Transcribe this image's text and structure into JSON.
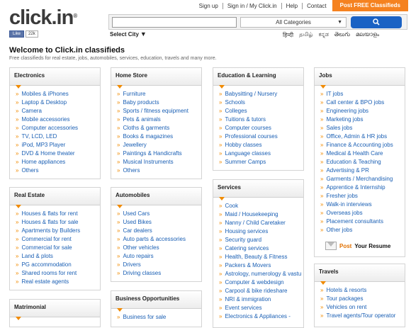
{
  "header": {
    "logo_text": "click.in",
    "logo_sup": "®",
    "like_label": "Like",
    "like_count": "22k",
    "nav": [
      "Sign up",
      "Sign in / My Click.in",
      "Help",
      "Contact"
    ],
    "post_button": "Post FREE Classifieds",
    "search_placeholder": "",
    "category_select": "All Categories",
    "city_label": "Select City",
    "languages": [
      "हिन्दी",
      "தமிழ்",
      "ಕನ್ನಡ",
      "తెలుగు",
      "മലയാളം"
    ]
  },
  "page": {
    "title": "Welcome to Click.in classifieds",
    "subtitle": "Free classifieds for real estate, jobs, automobiles, services, education, travels and many more."
  },
  "boxes": {
    "electronics": {
      "title": "Electronics",
      "items": [
        "Mobiles & iPhones",
        "Laptop & Desktop",
        "Camera",
        "Mobile accessories",
        "Computer accessories",
        "TV, LCD, LED",
        "iPod, MP3 Player",
        "DVD & Home theater",
        "Home appliances",
        "Others"
      ]
    },
    "home_store": {
      "title": "Home Store",
      "items": [
        "Furniture",
        "Baby products",
        "Sports / fitness equipment",
        "Pets & animals",
        "Cloths & garments",
        "Books & magazines",
        "Jewellery",
        "Paintings & Handicrafts",
        "Musical Instruments",
        "Others"
      ]
    },
    "education": {
      "title": "Education & Learning",
      "items": [
        "Babysitting / Nursery",
        "Schools",
        "Colleges",
        "Tuitions & tutors",
        "Computer courses",
        "Professional courses",
        "Hobby classes",
        "Language classes",
        "Summer Camps"
      ]
    },
    "jobs": {
      "title": "Jobs",
      "items": [
        "IT jobs",
        "Call center & BPO jobs",
        "Engineering jobs",
        "Marketing jobs",
        "Sales jobs",
        "Office, Admin & HR jobs",
        "Finance & Accounting jobs",
        "Medical & Health Care",
        "Education & Teaching",
        "Advertising & PR",
        "Garments / Merchandising",
        "Apprentice & Internship",
        "Fresher jobs",
        "Walk-in interviews",
        "Overseas jobs",
        "Placement consultants",
        "Other jobs"
      ]
    },
    "real_estate": {
      "title": "Real Estate",
      "items": [
        "Houses & flats for rent",
        "Houses & flats for sale",
        "Apartments by Builders",
        "Commercial for rent",
        "Commercial for sale",
        "Land & plots",
        "PG accommodation",
        "Shared rooms for rent",
        "Real estate agents"
      ]
    },
    "automobiles": {
      "title": "Automobiles",
      "items": [
        "Used Cars",
        "Used Bikes",
        "Car dealers",
        "Auto parts & accessories",
        "Other vehicles",
        "Auto repairs",
        "Drivers",
        "Driving classes"
      ]
    },
    "services": {
      "title": "Services",
      "items": [
        "Cook",
        "Maid / Housekeeping",
        "Nanny / Child Caretaker",
        "Housing services",
        "Security guard",
        "Catering services",
        "Health, Beauty & Fitness",
        "Packers & Movers",
        "Astrology, numerology & vastu",
        "Computer & webdesign",
        "Carpool & bike rideshare",
        "NRI & immigration",
        "Event services",
        "Electronics & Appliances -"
      ]
    },
    "matrimonial": {
      "title": "Matrimonial",
      "items": []
    },
    "business": {
      "title": "Business Opportunities",
      "items": [
        "Business for sale"
      ]
    },
    "travels": {
      "title": "Travels",
      "items": [
        "Hotels & resorts",
        "Tour packages",
        "Vehicles on rent",
        "Travel agents/Tour operator"
      ]
    }
  },
  "resume": {
    "post": "Post",
    "text": "Your Resume"
  }
}
